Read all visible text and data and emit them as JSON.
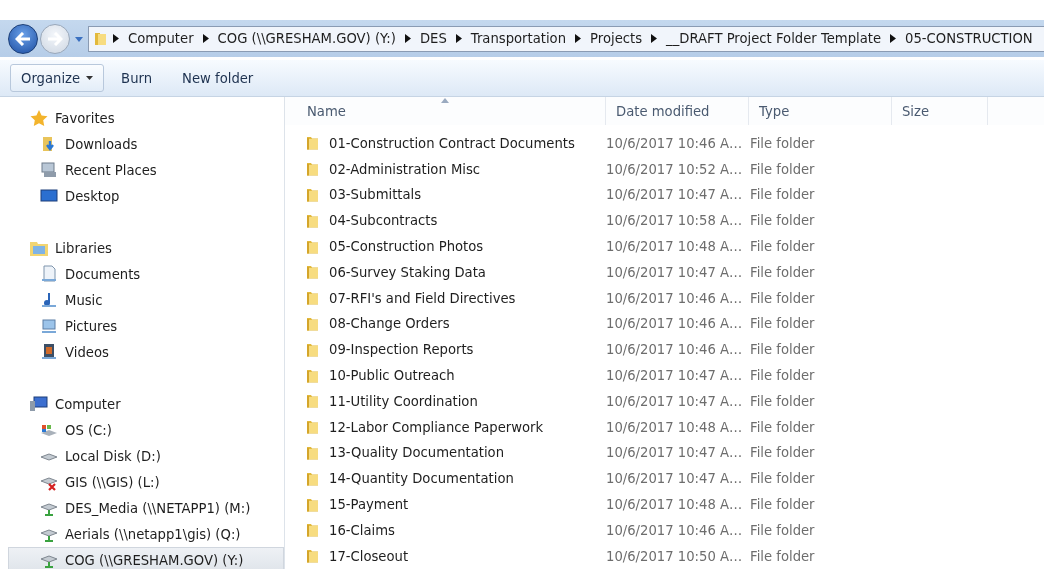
{
  "breadcrumb": [
    "Computer",
    "COG (\\\\GRESHAM.GOV) (Y:)",
    "DES",
    "Transportation",
    "Projects",
    "__DRAFT Project Folder Template",
    "05-CONSTRUCTION"
  ],
  "toolbar": [
    {
      "label": "Organize",
      "kind": "menu"
    },
    {
      "label": "Burn",
      "kind": "plain"
    },
    {
      "label": "New folder",
      "kind": "plain"
    }
  ],
  "navigation": [
    {
      "label": "Favorites",
      "kind": "favorites",
      "selected": false,
      "children": [
        {
          "label": "Downloads",
          "kind": "downloads",
          "selected": false
        },
        {
          "label": "Recent Places",
          "kind": "recent",
          "selected": false
        },
        {
          "label": "Desktop",
          "kind": "desktop",
          "selected": false
        }
      ]
    },
    {
      "label": "Libraries",
      "kind": "libraries",
      "selected": false,
      "children": [
        {
          "label": "Documents",
          "kind": "documents",
          "selected": false
        },
        {
          "label": "Music",
          "kind": "music",
          "selected": false
        },
        {
          "label": "Pictures",
          "kind": "pictures",
          "selected": false
        },
        {
          "label": "Videos",
          "kind": "videos",
          "selected": false
        }
      ]
    },
    {
      "label": "Computer",
      "kind": "computer",
      "selected": false,
      "children": [
        {
          "label": "OS (C:)",
          "kind": "system-drive",
          "selected": false
        },
        {
          "label": "Local Disk (D:)",
          "kind": "drive",
          "selected": false
        },
        {
          "label": "GIS (\\\\GIS) (L:)",
          "kind": "network-error",
          "selected": false
        },
        {
          "label": "DES_Media (\\\\NETAPP1) (M:)",
          "kind": "network",
          "selected": false
        },
        {
          "label": "Aerials (\\\\netapp1\\gis) (Q:)",
          "kind": "network",
          "selected": false
        },
        {
          "label": "COG (\\\\GRESHAM.GOV) (Y:)",
          "kind": "network",
          "selected": true
        }
      ]
    }
  ],
  "columns": [
    "Name",
    "Date modified",
    "Type",
    "Size"
  ],
  "rows": [
    {
      "name": "01-Construction Contract Documents",
      "date": "10/6/2017 10:46 A…",
      "type": "File folder"
    },
    {
      "name": "02-Administration Misc",
      "date": "10/6/2017 10:52 A…",
      "type": "File folder"
    },
    {
      "name": "03-Submittals",
      "date": "10/6/2017 10:47 A…",
      "type": "File folder"
    },
    {
      "name": "04-Subcontracts",
      "date": "10/6/2017 10:58 A…",
      "type": "File folder"
    },
    {
      "name": "05-Construction Photos",
      "date": "10/6/2017 10:48 A…",
      "type": "File folder"
    },
    {
      "name": "06-Survey Staking Data",
      "date": "10/6/2017 10:47 A…",
      "type": "File folder"
    },
    {
      "name": "07-RFI's and Field Directives",
      "date": "10/6/2017 10:46 A…",
      "type": "File folder"
    },
    {
      "name": "08-Change Orders",
      "date": "10/6/2017 10:46 A…",
      "type": "File folder"
    },
    {
      "name": "09-Inspection Reports",
      "date": "10/6/2017 10:46 A…",
      "type": "File folder"
    },
    {
      "name": "10-Public Outreach",
      "date": "10/6/2017 10:47 A…",
      "type": "File folder"
    },
    {
      "name": "11-Utility Coordination",
      "date": "10/6/2017 10:47 A…",
      "type": "File folder"
    },
    {
      "name": "12-Labor Compliance Paperwork",
      "date": "10/6/2017 10:48 A…",
      "type": "File folder"
    },
    {
      "name": "13-Quality Documentation",
      "date": "10/6/2017 10:47 A…",
      "type": "File folder"
    },
    {
      "name": "14-Quantity Documentation",
      "date": "10/6/2017 10:47 A…",
      "type": "File folder"
    },
    {
      "name": "15-Payment",
      "date": "10/6/2017 10:48 A…",
      "type": "File folder"
    },
    {
      "name": "16-Claims",
      "date": "10/6/2017 10:46 A…",
      "type": "File folder"
    },
    {
      "name": "17-Closeout",
      "date": "10/6/2017 10:50 A…",
      "type": "File folder"
    }
  ]
}
